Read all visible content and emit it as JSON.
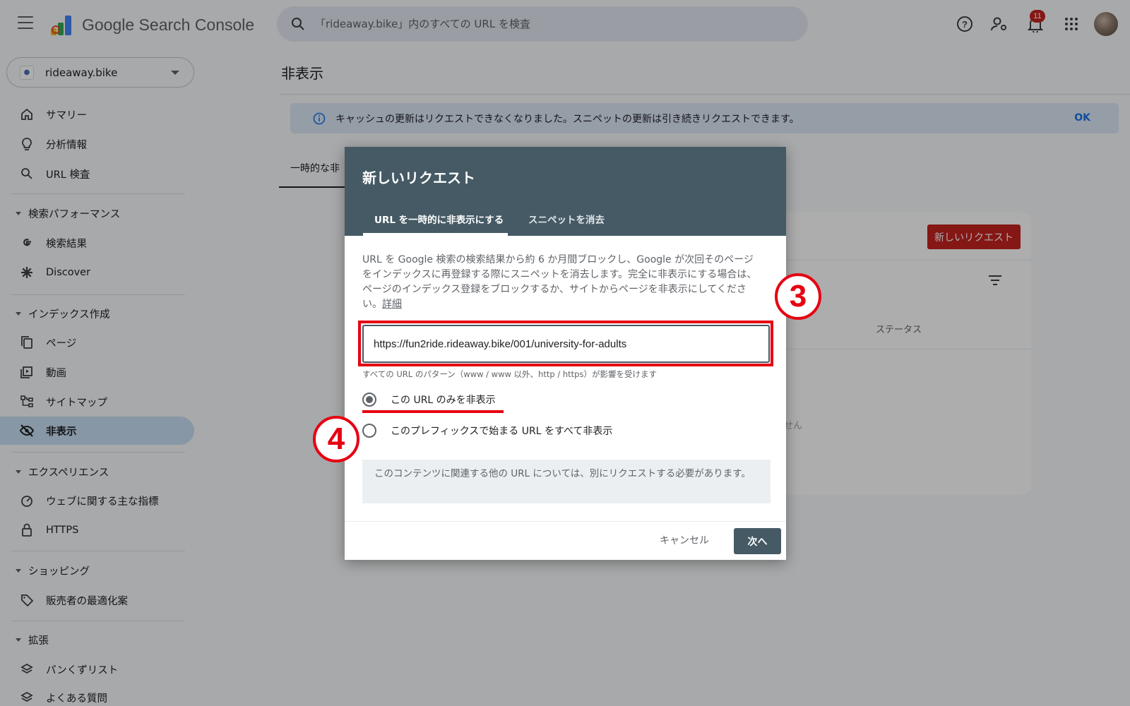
{
  "header": {
    "brand": "Google Search Console",
    "search_placeholder": "「rideaway.bike」内のすべての URL を検査",
    "notification_count": "11"
  },
  "sidebar": {
    "property": "rideaway.bike",
    "items": [
      {
        "label": "サマリー",
        "icon": "home-icon"
      },
      {
        "label": "分析情報",
        "icon": "lightbulb-icon"
      },
      {
        "label": "URL 検査",
        "icon": "search-icon"
      }
    ],
    "sections": [
      {
        "title": "検索パフォーマンス",
        "items": [
          {
            "label": "検索結果",
            "icon": "google-g-icon"
          },
          {
            "label": "Discover",
            "icon": "asterisk-icon"
          }
        ]
      },
      {
        "title": "インデックス作成",
        "items": [
          {
            "label": "ページ",
            "icon": "pages-icon"
          },
          {
            "label": "動画",
            "icon": "video-icon"
          },
          {
            "label": "サイトマップ",
            "icon": "sitemap-icon"
          },
          {
            "label": "非表示",
            "icon": "eye-off-icon",
            "active": true
          }
        ]
      },
      {
        "title": "エクスペリエンス",
        "items": [
          {
            "label": "ウェブに関する主な指標",
            "icon": "gauge-icon"
          },
          {
            "label": "HTTPS",
            "icon": "lock-icon"
          }
        ]
      },
      {
        "title": "ショッピング",
        "items": [
          {
            "label": "販売者の最適化案",
            "icon": "tag-icon"
          }
        ]
      },
      {
        "title": "拡張",
        "items": [
          {
            "label": "パンくずリスト",
            "icon": "layers-icon"
          },
          {
            "label": "よくある質問",
            "icon": "layers-icon"
          }
        ]
      }
    ]
  },
  "main": {
    "title": "非表示",
    "banner_text": "キャッシュの更新はリクエストできなくなりました。スニペットの更新は引き続きリクエストできます。",
    "banner_ok": "OK",
    "tab_partial": "一時的な非",
    "new_request_button": "新しいリクエスト",
    "status_header": "ステータス",
    "empty_partial": "せん"
  },
  "dialog": {
    "title": "新しいリクエスト",
    "tabs": [
      "URL を一時的に非表示にする",
      "スニペットを消去"
    ],
    "description": "URL を Google 検索の検索結果から約 6 か月間ブロックし、Google が次回そのページをインデックスに再登録する際にスニペットを消去します。完全に非表示にする場合は、ページのインデックス登録をブロックするか、サイトからページを非表示にしてください。",
    "details_link": "詳細",
    "url_value": "https://fun2ride.rideaway.bike/001/university-for-adults",
    "helper_text": "すべての URL のパターン（www / www 以外、http / https）が影響を受けます",
    "radio_options": [
      "この URL のみを非表示",
      "このプレフィックスで始まる URL をすべて非表示"
    ],
    "note": "このコンテンツに関連する他の URL については、別にリクエストする必要があります。",
    "cancel": "キャンセル",
    "next": "次へ"
  },
  "callouts": [
    "3",
    "4"
  ],
  "colors": {
    "accent_red": "#e60012",
    "dialog_header": "#455a64",
    "primary_button": "#c5221f",
    "active_nav": "#c9dff3"
  }
}
